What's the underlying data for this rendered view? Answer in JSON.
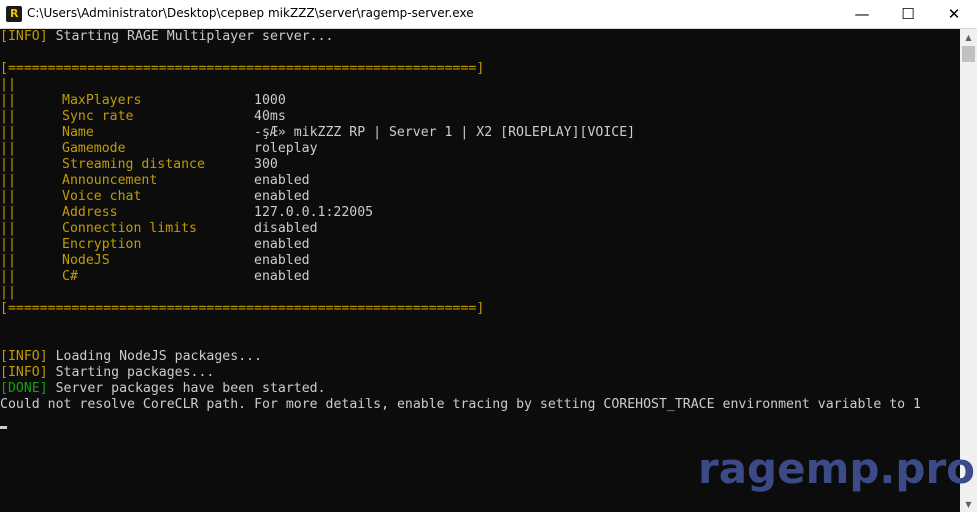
{
  "window": {
    "title": "C:\\Users\\Administrator\\Desktop\\сервер mikZZZ\\server\\ragemp-server.exe",
    "icon_letter": "R",
    "icons": {
      "app": "rage-logo-icon",
      "minimize": "minimize-icon",
      "maximize": "maximize-icon",
      "close": "close-icon"
    },
    "buttons": {
      "minimize": "—",
      "maximize": "☐",
      "close": "✕"
    }
  },
  "console": {
    "start": {
      "tag": "[INFO]",
      "text": " Starting RAGE Multiplayer server..."
    },
    "border": "[===========================================================]",
    "bar": "||",
    "config": [
      {
        "key": "MaxPlayers",
        "value": "1000"
      },
      {
        "key": "Sync rate",
        "value": "40ms"
      },
      {
        "key": "Name",
        "value": "-şÆ» mikZZZ RP | Server 1 | X2 [ROLEPLAY][VOICE]"
      },
      {
        "key": "Gamemode",
        "value": "roleplay"
      },
      {
        "key": "Streaming distance",
        "value": "300"
      },
      {
        "key": "Announcement",
        "value": "enabled"
      },
      {
        "key": "Voice chat",
        "value": "enabled"
      },
      {
        "key": "Address",
        "value": "127.0.0.1:22005"
      },
      {
        "key": "Connection limits",
        "value": "disabled"
      },
      {
        "key": "Encryption",
        "value": "enabled"
      },
      {
        "key": "NodeJS",
        "value": "enabled"
      },
      {
        "key": "C#",
        "value": "enabled"
      }
    ],
    "log": [
      {
        "tag": "[INFO]",
        "text": " Loading NodeJS packages..."
      },
      {
        "tag": "[INFO]",
        "text": " Starting packages..."
      },
      {
        "tag": "[DONE]",
        "text": " Server packages have been started."
      }
    ],
    "error": "Could not resolve CoreCLR path. For more details, enable tracing by setting COREHOST_TRACE environment variable to 1"
  },
  "scrollbar": {
    "up": "▲",
    "down": "▼"
  },
  "watermark": "ragemp.pro",
  "colors": {
    "yellow": "#c19c00",
    "green": "#13a10e",
    "text": "#cccccc",
    "background": "#0c0c0c"
  }
}
